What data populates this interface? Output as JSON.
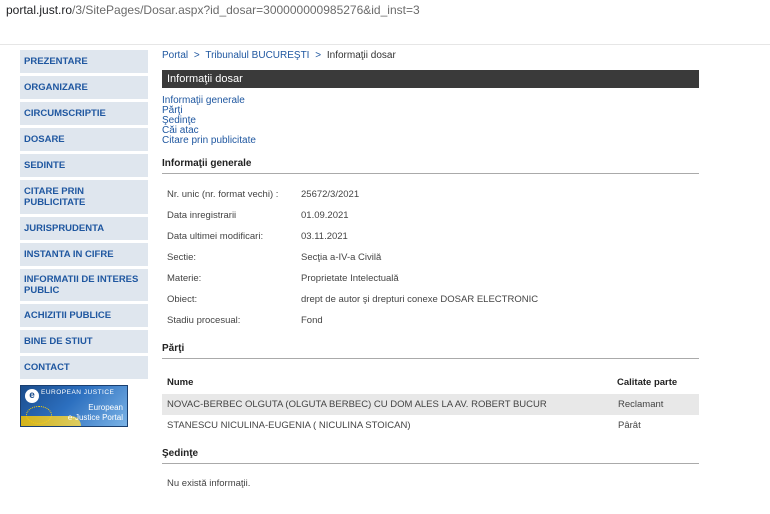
{
  "browser": {
    "url_host": "portal.just.ro",
    "url_path": "/3/SitePages/Dosar.aspx?id_dosar=300000000985276&id_inst=3"
  },
  "sidebar": {
    "items": [
      {
        "label": "PREZENTARE"
      },
      {
        "label": "ORGANIZARE"
      },
      {
        "label": "CIRCUMSCRIPTIE"
      },
      {
        "label": "DOSARE"
      },
      {
        "label": "SEDINTE"
      },
      {
        "label": "CITARE PRIN PUBLICITATE"
      },
      {
        "label": "JURISPRUDENTA"
      },
      {
        "label": "INSTANTA IN CIFRE"
      },
      {
        "label": "INFORMATII DE INTERES PUBLIC"
      },
      {
        "label": "ACHIZITII PUBLICE"
      },
      {
        "label": "BINE DE STIUT"
      },
      {
        "label": "CONTACT"
      }
    ],
    "banner": {
      "logo_letter": "e",
      "line1": "EUROPEAN JUSTICE",
      "line2": "European",
      "line3": "e-Justice Portal"
    }
  },
  "breadcrumb": {
    "portal": "Portal",
    "tribunal": "Tribunalul BUCUREŞTI",
    "current": "Informaţii dosar",
    "sep": ">"
  },
  "page_title": "Informaţii dosar",
  "quick_links": [
    "Informaţii generale",
    "Părţi",
    "Şedinţe",
    "Căi atac",
    "Citare prin publicitate"
  ],
  "general": {
    "heading": "Informaţii generale",
    "rows": [
      {
        "label": "Nr. unic (nr. format vechi) :",
        "value": "25672/3/2021"
      },
      {
        "label": "Data inregistrarii",
        "value": "01.09.2021"
      },
      {
        "label": "Data ultimei modificari:",
        "value": "03.11.2021"
      },
      {
        "label": "Sectie:",
        "value": "Secţia a-IV-a Civilă"
      },
      {
        "label": "Materie:",
        "value": "Proprietate Intelectuală"
      },
      {
        "label": "Obiect:",
        "value": "drept de autor şi drepturi conexe DOSAR ELECTRONIC"
      },
      {
        "label": "Stadiu procesual:",
        "value": "Fond"
      }
    ]
  },
  "parti": {
    "heading": "Părţi",
    "col_name": "Nume",
    "col_role": "Calitate parte",
    "rows": [
      {
        "name": "NOVAC-BERBEC OLGUTA (OLGUTA BERBEC) CU DOM ALES LA AV. ROBERT BUCUR",
        "role": "Reclamant"
      },
      {
        "name": "STANESCU NICULINA-EUGENIA ( NICULINA STOICAN)",
        "role": "Pârât"
      }
    ]
  },
  "sedinte": {
    "heading": "Şedinţe",
    "empty_text": "Nu există informaţii."
  },
  "colors": {
    "link": "#1f57a0",
    "nav_bg": "#dfe6ee",
    "titlebar_bg": "#3a3a3a",
    "alt_row": "#e8e8e8"
  }
}
